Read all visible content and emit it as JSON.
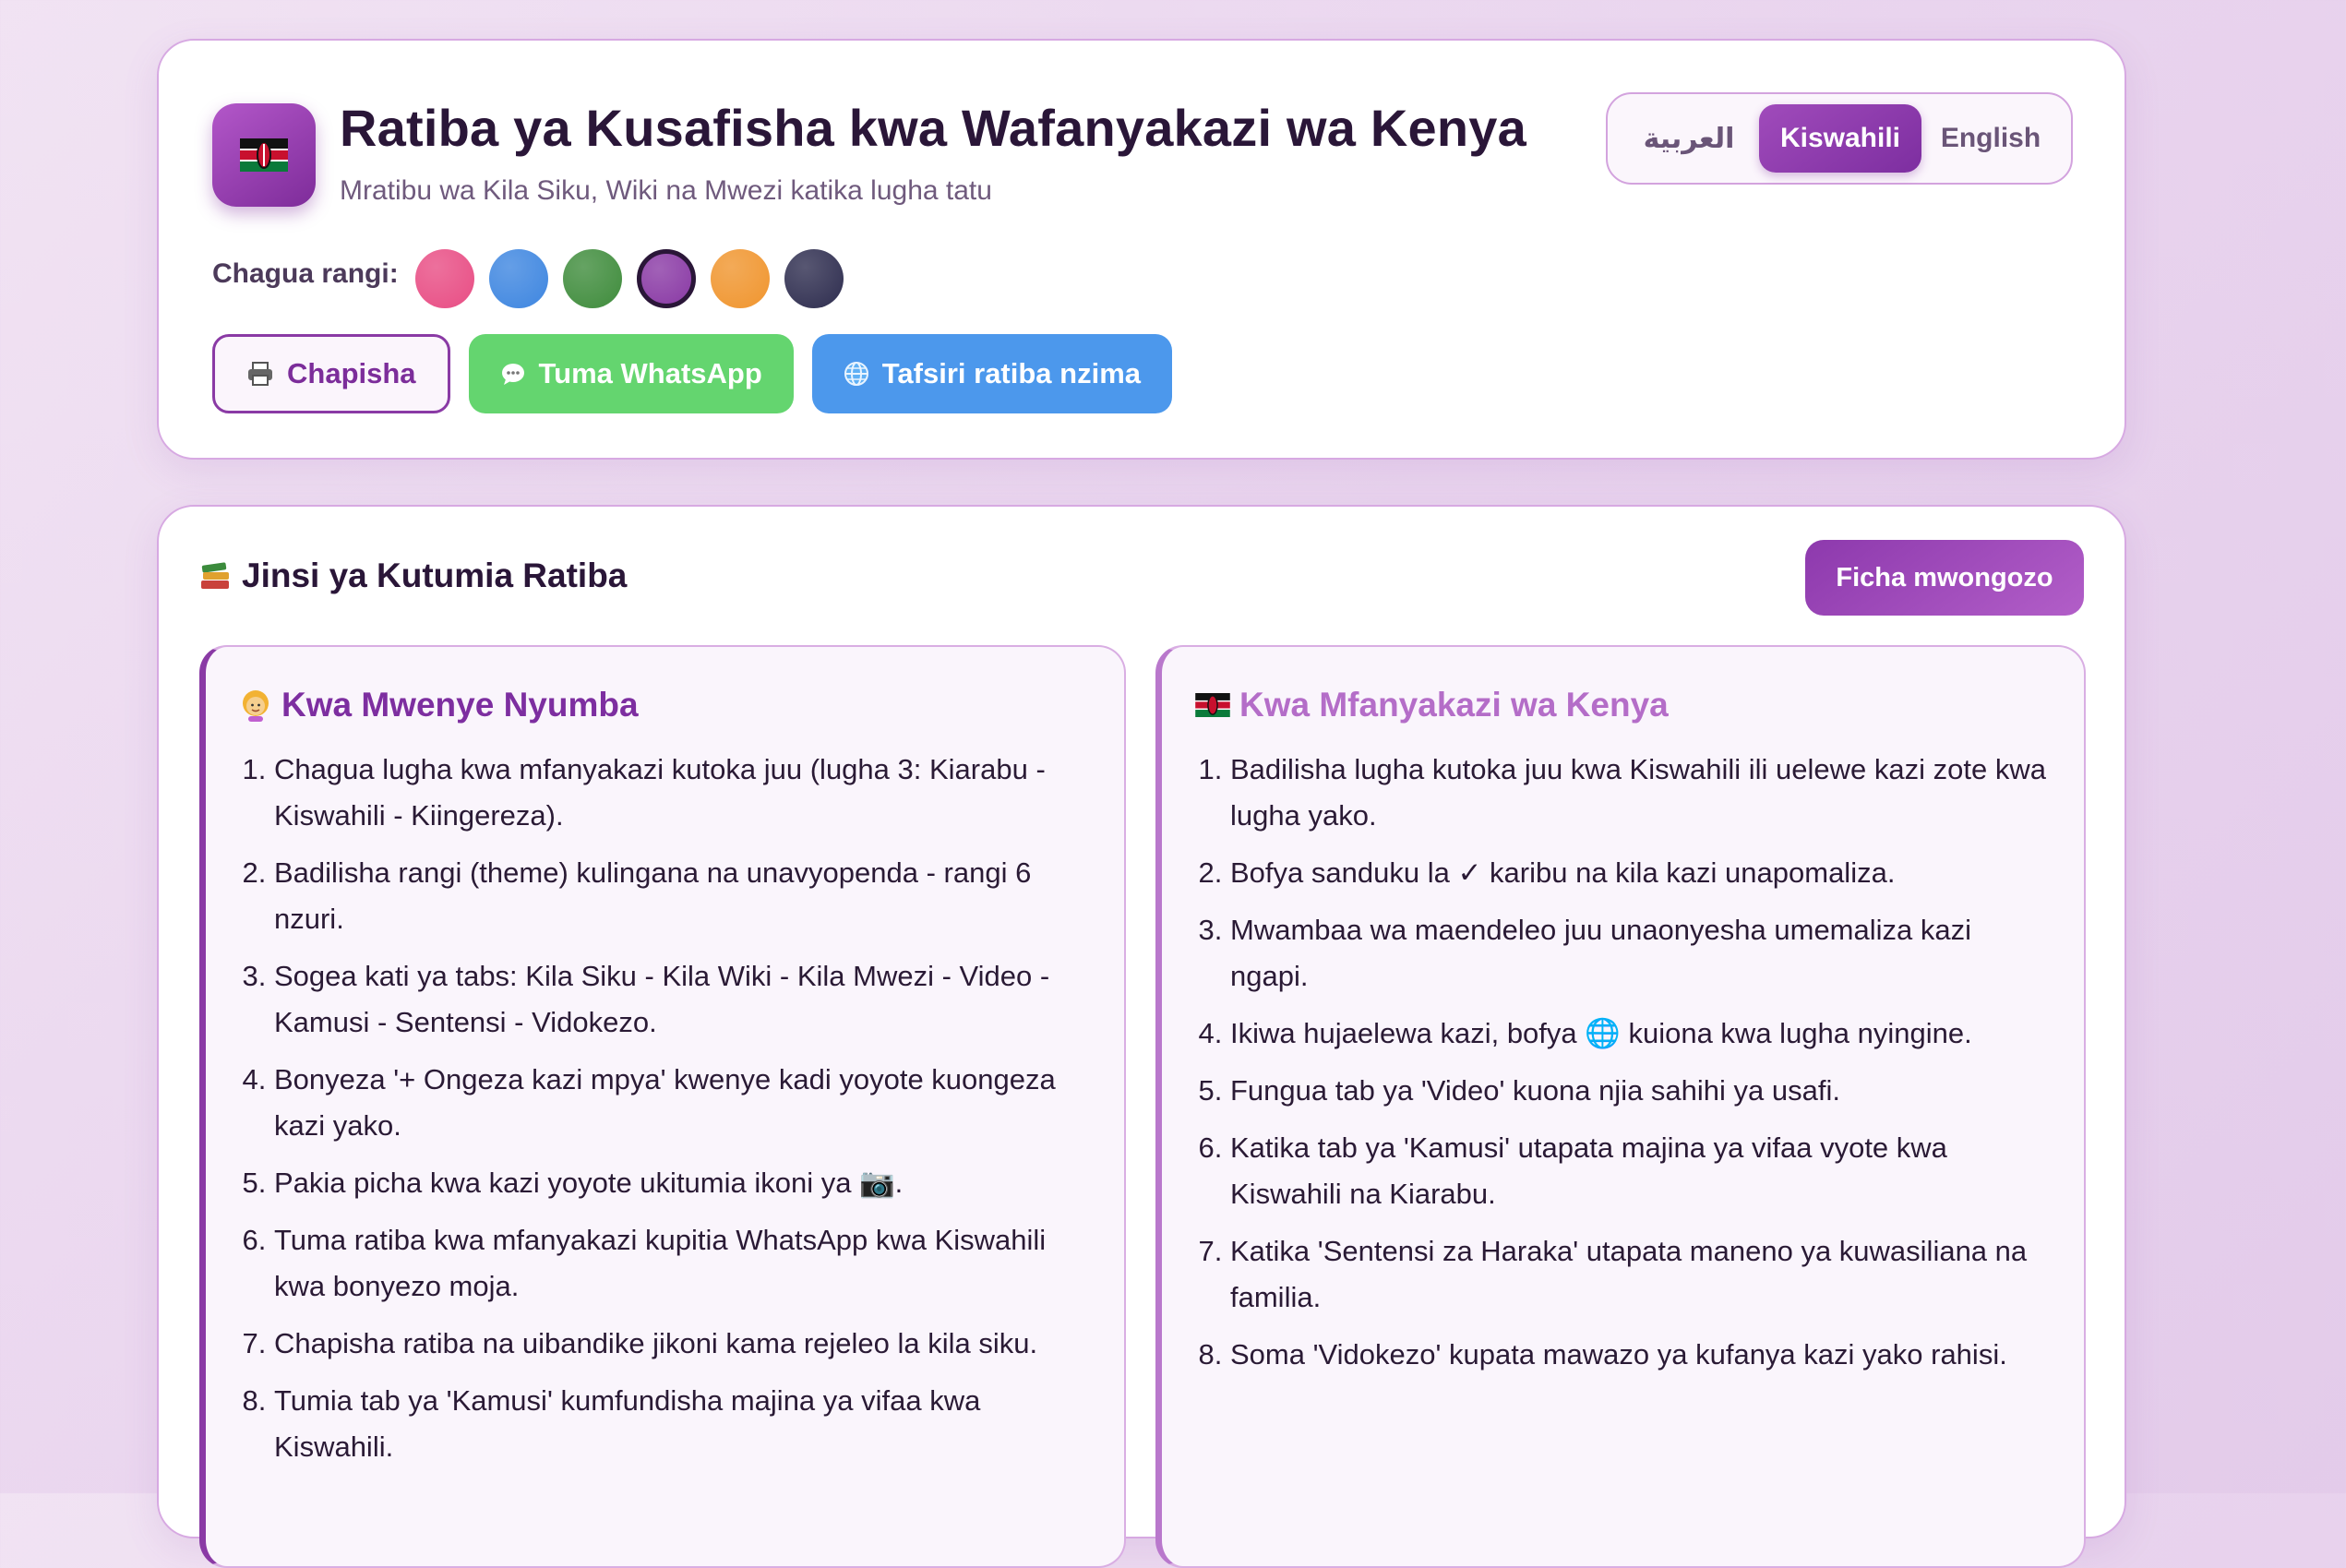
{
  "header": {
    "title": "Ratiba ya Kusafisha kwa Wafanyakazi wa Kenya",
    "subtitle": "Mratibu wa Kila Siku, Wiki na Mwezi katika lugha tatu",
    "logo_icon": "kenya-flag-icon"
  },
  "languages": [
    {
      "label": "العربية",
      "active": false
    },
    {
      "label": "Kiswahili",
      "active": true
    },
    {
      "label": "English",
      "active": false
    }
  ],
  "theme": {
    "label": "Chagua rangi:",
    "colors": [
      "#e84d84",
      "#3e86e0",
      "#3f8c3c",
      "#8a3aa5",
      "#f0952e",
      "#2e2d4f"
    ],
    "selected_index": 3
  },
  "actions": {
    "print": {
      "label": "Chapisha",
      "icon": "printer-icon"
    },
    "whatsapp": {
      "label": "Tuma WhatsApp",
      "icon": "chat-bubble-icon"
    },
    "translate": {
      "label": "Tafsiri ratiba nzima",
      "icon": "globe-icon"
    }
  },
  "guide": {
    "title": "Jinsi ya Kutumia Ratiba",
    "title_icon": "books-icon",
    "hide_label": "Ficha mwongozo",
    "owner": {
      "title": "Kwa Mwenye Nyumba",
      "icon": "woman-icon",
      "steps": [
        "Chagua lugha kwa mfanyakazi kutoka juu (lugha 3: Kiarabu - Kiswahili - Kiingereza).",
        "Badilisha rangi (theme) kulingana na unavyopenda - rangi 6 nzuri.",
        "Sogea kati ya tabs: Kila Siku - Kila Wiki - Kila Mwezi - Video - Kamusi - Sentensi - Vidokezo.",
        "Bonyeza '+ Ongeza kazi mpya' kwenye kadi yoyote kuongeza kazi yako.",
        "Pakia picha kwa kazi yoyote ukitumia ikoni ya 📷.",
        "Tuma ratiba kwa mfanyakazi kupitia WhatsApp kwa Kiswahili kwa bonyezo moja.",
        "Chapisha ratiba na uibandike jikoni kama rejeleo la kila siku.",
        "Tumia tab ya 'Kamusi' kumfundisha majina ya vifaa kwa Kiswahili."
      ]
    },
    "worker": {
      "title": "Kwa Mfanyakazi wa Kenya",
      "icon": "kenya-flag-icon",
      "steps": [
        "Badilisha lugha kutoka juu kwa Kiswahili ili uelewe kazi zote kwa lugha yako.",
        "Bofya sanduku la ✓ karibu na kila kazi unapomaliza.",
        "Mwambaa wa maendeleo juu unaonyesha umemaliza kazi ngapi.",
        "Ikiwa hujaelewa kazi, bofya 🌐 kuiona kwa lugha nyingine.",
        "Fungua tab ya 'Video' kuona njia sahihi ya usafi.",
        "Katika tab ya 'Kamusi' utapata majina ya vifaa vyote kwa Kiswahili na Kiarabu.",
        "Katika 'Sentensi za Haraka' utapata maneno ya kuwasiliana na familia.",
        "Soma 'Vidokezo' kupata mawazo ya kufanya kazi yako rahisi."
      ]
    }
  }
}
